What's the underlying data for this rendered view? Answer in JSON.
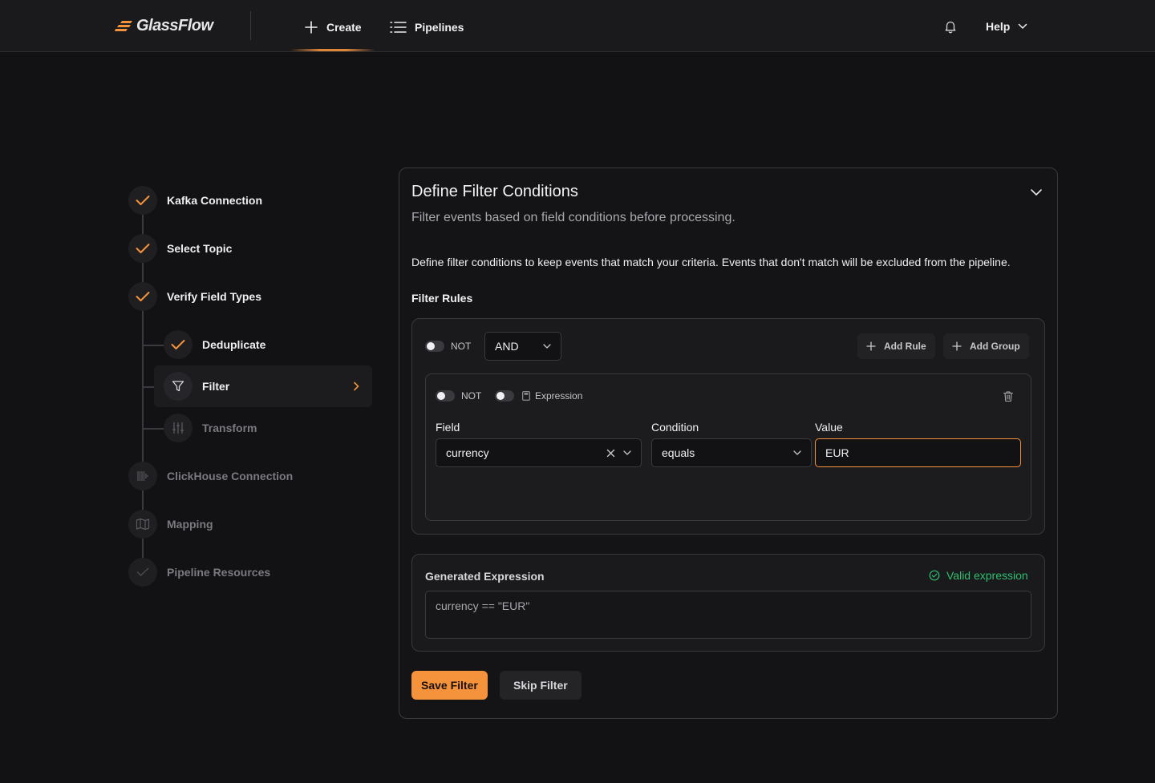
{
  "app": {
    "name": "GlassFlow",
    "accent_color": "#f5923c",
    "success_color": "#2fbf71"
  },
  "topbar": {
    "create_label": "Create",
    "pipelines_label": "Pipelines",
    "help_label": "Help"
  },
  "stepper": {
    "steps": [
      {
        "label": "Kafka Connection",
        "status": "done"
      },
      {
        "label": "Select Topic",
        "status": "done"
      },
      {
        "label": "Verify Field Types",
        "status": "done"
      },
      {
        "label": "Deduplicate",
        "status": "done"
      },
      {
        "label": "Filter",
        "status": "active"
      },
      {
        "label": "Transform",
        "status": "pending"
      },
      {
        "label": "ClickHouse Connection",
        "status": "pending"
      },
      {
        "label": "Mapping",
        "status": "pending"
      },
      {
        "label": "Pipeline Resources",
        "status": "pending"
      }
    ]
  },
  "card": {
    "title": "Define Filter Conditions",
    "subtitle": "Filter events based on field conditions before processing.",
    "description": "Define filter conditions to keep events that match your criteria. Events that don't match will be excluded from the pipeline.",
    "rules_title": "Filter Rules"
  },
  "group": {
    "not_label": "NOT",
    "operator": "AND",
    "add_rule_label": "Add Rule",
    "add_group_label": "Add Group"
  },
  "rule": {
    "not_label": "NOT",
    "expression_label": "Expression",
    "field_label": "Field",
    "field_value": "currency",
    "condition_label": "Condition",
    "condition_value": "equals",
    "value_label": "Value",
    "value_value": "EUR"
  },
  "expression": {
    "title": "Generated Expression",
    "status": "Valid expression",
    "value": "currency == \"EUR\""
  },
  "actions": {
    "save_label": "Save Filter",
    "skip_label": "Skip Filter"
  }
}
